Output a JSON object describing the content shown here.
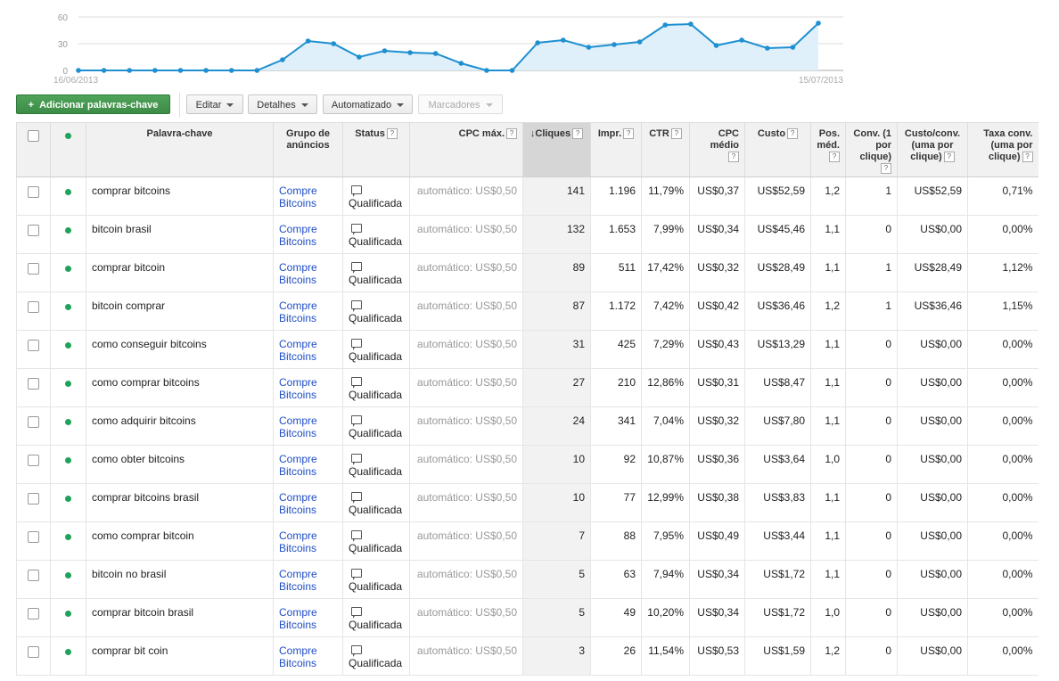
{
  "chart_data": {
    "type": "area",
    "x": [
      "16/06/2013",
      "17/06/2013",
      "18/06/2013",
      "19/06/2013",
      "20/06/2013",
      "21/06/2013",
      "22/06/2013",
      "23/06/2013",
      "24/06/2013",
      "25/06/2013",
      "26/06/2013",
      "27/06/2013",
      "28/06/2013",
      "29/06/2013",
      "30/06/2013",
      "01/07/2013",
      "02/07/2013",
      "03/07/2013",
      "04/07/2013",
      "05/07/2013",
      "06/07/2013",
      "07/07/2013",
      "08/07/2013",
      "09/07/2013",
      "10/07/2013",
      "11/07/2013",
      "12/07/2013",
      "13/07/2013",
      "14/07/2013",
      "15/07/2013"
    ],
    "values": [
      0,
      0,
      0,
      0,
      0,
      0,
      0,
      0,
      12,
      33,
      30,
      15,
      22,
      20,
      19,
      8,
      0,
      0,
      31,
      34,
      26,
      29,
      32,
      51,
      52,
      28,
      34,
      25,
      26,
      53
    ],
    "y_ticks": [
      "60",
      "30",
      "0"
    ],
    "ylim": [
      0,
      60
    ],
    "x_start_label": "16/06/2013",
    "x_end_label": "15/07/2013",
    "line_color": "#1e8fd0",
    "fill_color": "#dff0fa"
  },
  "toolbar": {
    "add_keywords": "Adicionar palavras-chave",
    "edit": "Editar",
    "details": "Detalhes",
    "automated": "Automatizado",
    "labels": "Marcadores"
  },
  "table": {
    "headers": {
      "keyword": "Palavra-chave",
      "adgroup": "Grupo de anúncios",
      "status": "Status",
      "max_cpc": "CPC máx.",
      "clicks": "Cliques",
      "impr": "Impr.",
      "ctr": "CTR",
      "avg_cpc": "CPC médio",
      "cost": "Custo",
      "avg_pos": "Pos. méd.",
      "conv": "Conv. (1 por clique)",
      "cost_conv": "Custo/conv. (uma por clique)",
      "conv_rate": "Taxa conv. (uma por clique)",
      "help": "?",
      "sort_arrow": "↓"
    },
    "rows": [
      {
        "keyword": "comprar bitcoins",
        "adgroup": "Compre Bitcoins",
        "status": "Qualificada",
        "max_cpc": "automático: US$0,50",
        "clicks": "141",
        "impr": "1.196",
        "ctr": "11,79%",
        "avg_cpc": "US$0,37",
        "cost": "US$52,59",
        "avg_pos": "1,2",
        "conv": "1",
        "cost_conv": "US$52,59",
        "conv_rate": "0,71%"
      },
      {
        "keyword": "bitcoin brasil",
        "adgroup": "Compre Bitcoins",
        "status": "Qualificada",
        "max_cpc": "automático: US$0,50",
        "clicks": "132",
        "impr": "1.653",
        "ctr": "7,99%",
        "avg_cpc": "US$0,34",
        "cost": "US$45,46",
        "avg_pos": "1,1",
        "conv": "0",
        "cost_conv": "US$0,00",
        "conv_rate": "0,00%"
      },
      {
        "keyword": "comprar bitcoin",
        "adgroup": "Compre Bitcoins",
        "status": "Qualificada",
        "max_cpc": "automático: US$0,50",
        "clicks": "89",
        "impr": "511",
        "ctr": "17,42%",
        "avg_cpc": "US$0,32",
        "cost": "US$28,49",
        "avg_pos": "1,1",
        "conv": "1",
        "cost_conv": "US$28,49",
        "conv_rate": "1,12%"
      },
      {
        "keyword": "bitcoin comprar",
        "adgroup": "Compre Bitcoins",
        "status": "Qualificada",
        "max_cpc": "automático: US$0,50",
        "clicks": "87",
        "impr": "1.172",
        "ctr": "7,42%",
        "avg_cpc": "US$0,42",
        "cost": "US$36,46",
        "avg_pos": "1,2",
        "conv": "1",
        "cost_conv": "US$36,46",
        "conv_rate": "1,15%"
      },
      {
        "keyword": "como conseguir bitcoins",
        "adgroup": "Compre Bitcoins",
        "status": "Qualificada",
        "max_cpc": "automático: US$0,50",
        "clicks": "31",
        "impr": "425",
        "ctr": "7,29%",
        "avg_cpc": "US$0,43",
        "cost": "US$13,29",
        "avg_pos": "1,1",
        "conv": "0",
        "cost_conv": "US$0,00",
        "conv_rate": "0,00%"
      },
      {
        "keyword": "como comprar bitcoins",
        "adgroup": "Compre Bitcoins",
        "status": "Qualificada",
        "max_cpc": "automático: US$0,50",
        "clicks": "27",
        "impr": "210",
        "ctr": "12,86%",
        "avg_cpc": "US$0,31",
        "cost": "US$8,47",
        "avg_pos": "1,1",
        "conv": "0",
        "cost_conv": "US$0,00",
        "conv_rate": "0,00%"
      },
      {
        "keyword": "como adquirir bitcoins",
        "adgroup": "Compre Bitcoins",
        "status": "Qualificada",
        "max_cpc": "automático: US$0,50",
        "clicks": "24",
        "impr": "341",
        "ctr": "7,04%",
        "avg_cpc": "US$0,32",
        "cost": "US$7,80",
        "avg_pos": "1,1",
        "conv": "0",
        "cost_conv": "US$0,00",
        "conv_rate": "0,00%"
      },
      {
        "keyword": "como obter bitcoins",
        "adgroup": "Compre Bitcoins",
        "status": "Qualificada",
        "max_cpc": "automático: US$0,50",
        "clicks": "10",
        "impr": "92",
        "ctr": "10,87%",
        "avg_cpc": "US$0,36",
        "cost": "US$3,64",
        "avg_pos": "1,0",
        "conv": "0",
        "cost_conv": "US$0,00",
        "conv_rate": "0,00%"
      },
      {
        "keyword": "comprar bitcoins brasil",
        "adgroup": "Compre Bitcoins",
        "status": "Qualificada",
        "max_cpc": "automático: US$0,50",
        "clicks": "10",
        "impr": "77",
        "ctr": "12,99%",
        "avg_cpc": "US$0,38",
        "cost": "US$3,83",
        "avg_pos": "1,1",
        "conv": "0",
        "cost_conv": "US$0,00",
        "conv_rate": "0,00%"
      },
      {
        "keyword": "como comprar bitcoin",
        "adgroup": "Compre Bitcoins",
        "status": "Qualificada",
        "max_cpc": "automático: US$0,50",
        "clicks": "7",
        "impr": "88",
        "ctr": "7,95%",
        "avg_cpc": "US$0,49",
        "cost": "US$3,44",
        "avg_pos": "1,1",
        "conv": "0",
        "cost_conv": "US$0,00",
        "conv_rate": "0,00%"
      },
      {
        "keyword": "bitcoin no brasil",
        "adgroup": "Compre Bitcoins",
        "status": "Qualificada",
        "max_cpc": "automático: US$0,50",
        "clicks": "5",
        "impr": "63",
        "ctr": "7,94%",
        "avg_cpc": "US$0,34",
        "cost": "US$1,72",
        "avg_pos": "1,1",
        "conv": "0",
        "cost_conv": "US$0,00",
        "conv_rate": "0,00%"
      },
      {
        "keyword": "comprar bitcoin brasil",
        "adgroup": "Compre Bitcoins",
        "status": "Qualificada",
        "max_cpc": "automático: US$0,50",
        "clicks": "5",
        "impr": "49",
        "ctr": "10,20%",
        "avg_cpc": "US$0,34",
        "cost": "US$1,72",
        "avg_pos": "1,0",
        "conv": "0",
        "cost_conv": "US$0,00",
        "conv_rate": "0,00%"
      },
      {
        "keyword": "comprar bit coin",
        "adgroup": "Compre Bitcoins",
        "status": "Qualificada",
        "max_cpc": "automático: US$0,50",
        "clicks": "3",
        "impr": "26",
        "ctr": "11,54%",
        "avg_cpc": "US$0,53",
        "cost": "US$1,59",
        "avg_pos": "1,2",
        "conv": "0",
        "cost_conv": "US$0,00",
        "conv_rate": "0,00%"
      }
    ]
  }
}
